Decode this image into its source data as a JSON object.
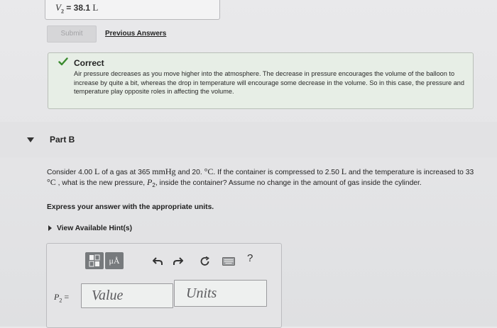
{
  "previous_answer": {
    "variable": "V",
    "subscript": "2",
    "equals": "=",
    "value": "38.1",
    "unit": "L"
  },
  "actions": {
    "submit_label": "Submit",
    "previous_answers_label": "Previous Answers"
  },
  "feedback": {
    "status": "Correct",
    "icon": "checkmark-icon",
    "color": "#3a8a2e",
    "message": "Air pressure decreases as you move higher into the atmosphere. The decrease in pressure encourages the volume of the balloon to increase by quite a bit, whereas the drop in temperature will encourage some decrease in the volume. So in this case, the pressure and temperature play opposite roles in affecting the volume."
  },
  "part_b": {
    "label": "Part B",
    "question": {
      "s1": "Consider 4.00 ",
      "u1": "L",
      "s2": " of a gas at 365 ",
      "u2": "mmHg",
      "s3": " and 20. ",
      "u3": "°C",
      "s4": ". If the container is compressed to 2.50 ",
      "u4": "L",
      "s5": " and the temperature is increased to 33 ",
      "u5": "°C",
      "s6": " , what is the new pressure, ",
      "v1": "P",
      "v1sub": "2",
      "s7": ", inside the container? Assume no change in the amount of gas inside the cylinder."
    },
    "instruction": "Express your answer with the appropriate units.",
    "hint_link": "View Available Hint(s)"
  },
  "answer_panel": {
    "toolbar": {
      "units_label": "μÅ",
      "help_label": "?"
    },
    "variable": "P",
    "subscript": "2",
    "equals": "=",
    "value_placeholder": "Value",
    "units_placeholder": "Units"
  }
}
